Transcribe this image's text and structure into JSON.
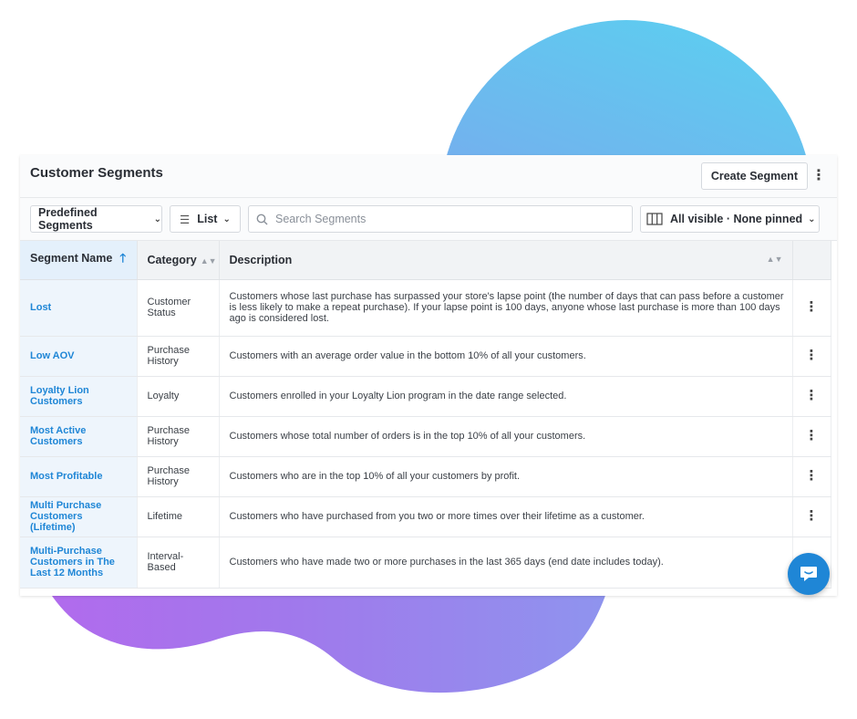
{
  "header": {
    "title": "Customer Segments",
    "create_label": "Create Segment",
    "more_icon": "more-vertical-icon"
  },
  "toolbar": {
    "predefined_label": "Predefined Segments",
    "list_label": "List",
    "search_placeholder": "Search Segments",
    "search_value": "",
    "columns_label": "All visible · None pinned"
  },
  "table": {
    "columns": [
      "Segment Name",
      "Category",
      "Description"
    ],
    "rows": [
      {
        "name": "Lost",
        "category": "Customer Status",
        "description": "Customers whose last purchase has surpassed your store's lapse point (the number of days that can pass before a customer is less likely to make a repeat purchase). If your lapse point is 100 days, anyone whose last purchase is more than 100 days ago is considered lost."
      },
      {
        "name": "Low AOV",
        "category": "Purchase History",
        "description": "Customers with an average order value in the bottom 10% of all your customers."
      },
      {
        "name": "Loyalty Lion Customers",
        "category": "Loyalty",
        "description": "Customers enrolled in your Loyalty Lion program in the date range selected."
      },
      {
        "name": "Most Active Customers",
        "category": "Purchase History",
        "description": "Customers whose total number of orders is in the top 10% of all your customers."
      },
      {
        "name": "Most Profitable",
        "category": "Purchase History",
        "description": "Customers who are in the top 10% of all your customers by profit."
      },
      {
        "name": "Multi Purchase Customers (Lifetime)",
        "category": "Lifetime",
        "description": "Customers who have purchased from you two or more times over their lifetime as a customer."
      },
      {
        "name": "Multi-Purchase Customers in The Last 12 Months",
        "category": "Interval-Based",
        "description": "Customers who have made two or more purchases in the last 365 days (end date includes today)."
      }
    ]
  },
  "colors": {
    "accent": "#1f86d6",
    "blob_blue": "#5ad1f0",
    "blob_purple": "#b26aed"
  }
}
